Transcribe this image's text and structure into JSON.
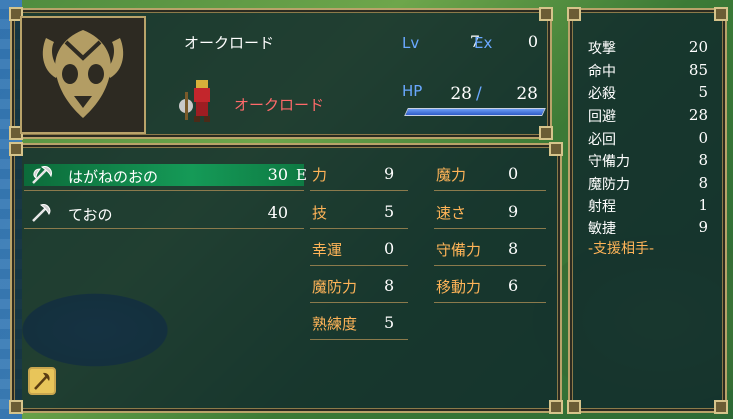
{
  "unit": {
    "name": "オークロード",
    "class": "オークロード",
    "lv_label": "Lv",
    "lv": "7",
    "ex_label": "Ex",
    "ex": "0",
    "hp_label": "HP",
    "hp_current": "28",
    "hp_slash": "/",
    "hp_max": "28",
    "hp_fraction": 1.0
  },
  "items": [
    {
      "name": "はがねのおの",
      "uses": "30",
      "equip": "E",
      "icon": "axe-icon",
      "equipped": true
    },
    {
      "name": "ておの",
      "uses": "40",
      "equip": "",
      "icon": "hand-axe-icon",
      "equipped": false
    }
  ],
  "stats_left": [
    {
      "label": "力",
      "value": "9"
    },
    {
      "label": "技",
      "value": "5"
    },
    {
      "label": "幸運",
      "value": "0"
    },
    {
      "label": "魔防力",
      "value": "8"
    },
    {
      "label": "熟練度",
      "value": "5"
    }
  ],
  "stats_right": [
    {
      "label": "魔力",
      "value": "0"
    },
    {
      "label": "速さ",
      "value": "9"
    },
    {
      "label": "守備力",
      "value": "8"
    },
    {
      "label": "移動力",
      "value": "6"
    }
  ],
  "combat": [
    {
      "label": "攻撃",
      "value": "20"
    },
    {
      "label": "命中",
      "value": "85"
    },
    {
      "label": "必殺",
      "value": "5"
    },
    {
      "label": "回避",
      "value": "28"
    },
    {
      "label": "必回",
      "value": "0"
    },
    {
      "label": "守備力",
      "value": "8"
    },
    {
      "label": "魔防力",
      "value": "8"
    },
    {
      "label": "射程",
      "value": "1"
    },
    {
      "label": "敏捷",
      "value": "9"
    }
  ],
  "support_title": "-支援相手-",
  "colors": {
    "stat_label": "#ffb458",
    "class_name": "#ff6a6a",
    "blue_label": "#6aa8ff",
    "equipped_row": "#159a57",
    "frame": "#b9a36a"
  },
  "icons": {
    "weapon_rank": "axe-rank-icon",
    "portrait": "orc-emblem-portrait"
  }
}
